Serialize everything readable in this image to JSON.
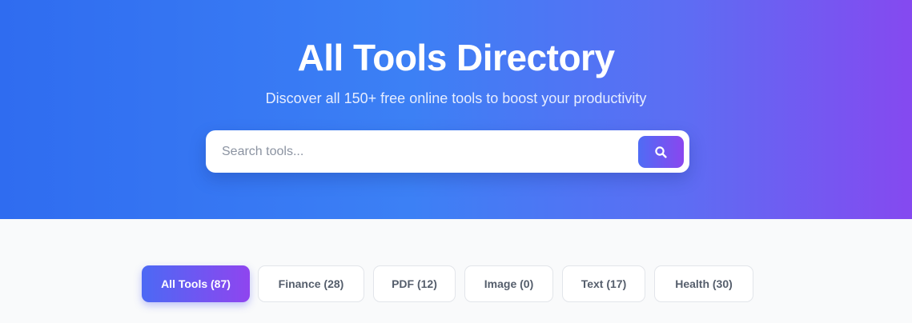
{
  "hero": {
    "title": "All Tools Directory",
    "subtitle": "Discover all 150+ free online tools to boost your productivity"
  },
  "search": {
    "placeholder": "Search tools...",
    "value": "",
    "button_icon": "search-icon"
  },
  "filters": [
    {
      "label": "All Tools (87)",
      "active": true
    },
    {
      "label": "Finance (28)",
      "active": false
    },
    {
      "label": "PDF (12)",
      "active": false
    },
    {
      "label": "Image (0)",
      "active": false
    },
    {
      "label": "Text (17)",
      "active": false
    },
    {
      "label": "Health (30)",
      "active": false
    }
  ],
  "colors": {
    "hero_gradient_start": "#2f6cf0",
    "hero_gradient_end": "#8549f0",
    "accent_start": "#4c69f4",
    "accent_end": "#8f45ef",
    "page_background": "#f9fafb"
  }
}
